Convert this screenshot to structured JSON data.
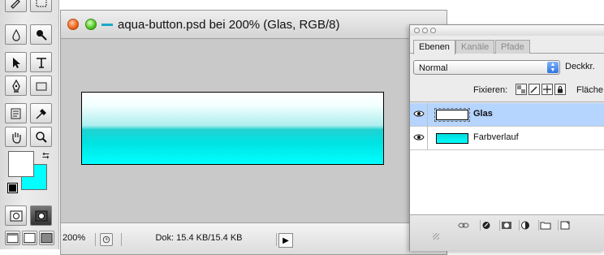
{
  "document": {
    "title": "aqua-button.psd bei 200% (Glas, RGB/8)",
    "zoom": "200%",
    "doc_info": "Dok: 15.4 KB/15.4 KB"
  },
  "tools": {
    "colors": {
      "foreground": "#ffffff",
      "background": "#00ffff"
    }
  },
  "layers_palette": {
    "tabs": [
      "Ebenen",
      "Kanäle",
      "Pfade"
    ],
    "active_tab": "Ebenen",
    "blend_mode": "Normal",
    "opacity_label": "Deckkr.",
    "lock_label": "Fixieren:",
    "fill_label": "Fläche",
    "layers": [
      {
        "name": "Glas",
        "visible": true,
        "selected": true
      },
      {
        "name": "Farbverlauf",
        "visible": true,
        "selected": false
      }
    ]
  },
  "icons": [
    "pencil-icon",
    "rectangle-marquee-icon",
    "drop-icon",
    "burn-icon",
    "pointer-icon",
    "text-tool-icon",
    "pen-icon",
    "shape-rect-icon",
    "notes-icon",
    "eyedropper-icon",
    "hand-icon",
    "magnify-icon",
    "eye-icon",
    "link-icon",
    "layer-style-icon",
    "mask-icon",
    "adjustment-icon",
    "folder-icon",
    "new-layer-icon"
  ],
  "accent_colors": {
    "selection": "#b5d5ff",
    "aqua": "#00ffff"
  }
}
